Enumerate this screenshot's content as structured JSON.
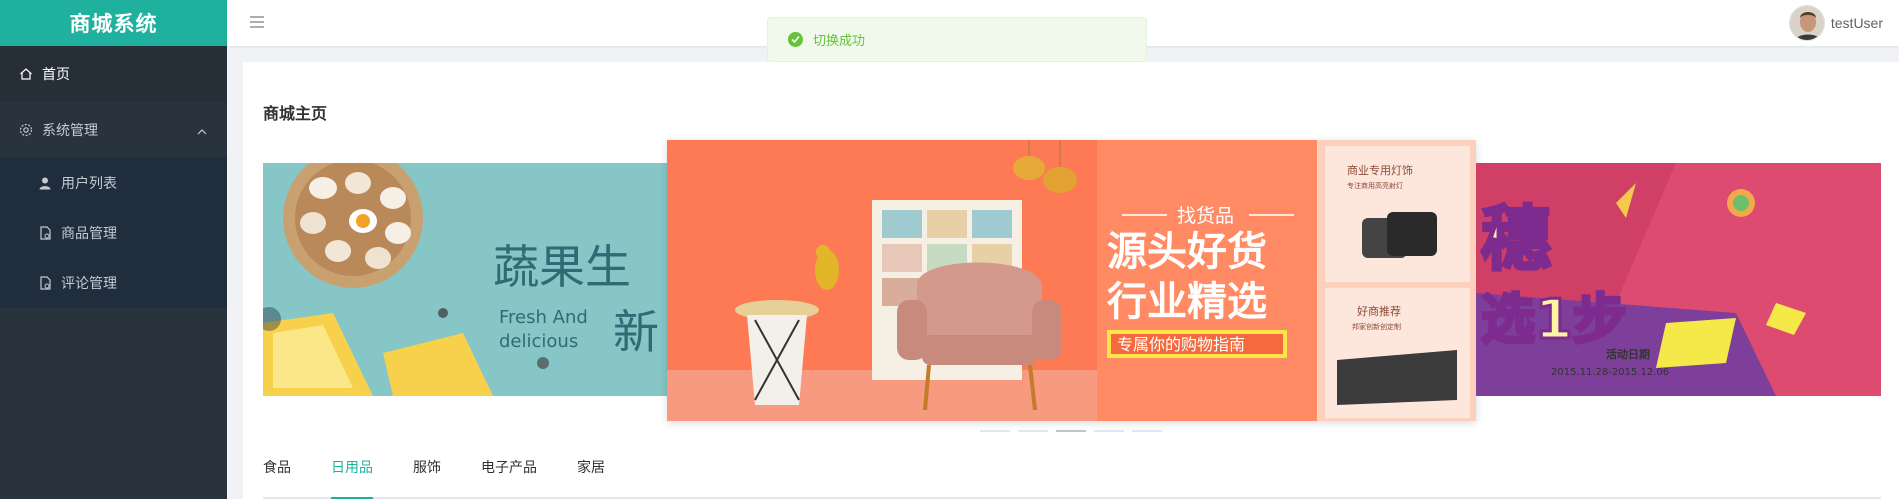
{
  "sidebar": {
    "logo": "商城系统",
    "items": [
      {
        "label": "首页",
        "icon": "home-icon"
      },
      {
        "label": "系统管理",
        "icon": "gear-icon"
      }
    ],
    "submenu": [
      {
        "label": "用户列表",
        "icon": "user-icon"
      },
      {
        "label": "商品管理",
        "icon": "document-icon"
      },
      {
        "label": "评论管理",
        "icon": "document-icon"
      }
    ]
  },
  "header": {
    "username": "testUser"
  },
  "toast": {
    "message": "切换成功"
  },
  "main": {
    "title": "商城主页",
    "carousel": {
      "left": {
        "title": "蔬果生",
        "subtitle_en_1": "Fresh And",
        "subtitle_en_2": "delicious",
        "title_2": "新"
      },
      "center": {
        "kicker": "找货品",
        "line1": "源头好货",
        "line2": "行业精选",
        "banner": "专属你的购物指南",
        "side_top_title": "商业专用灯饰",
        "side_top_sub": "专注商用高亮射灯",
        "side_bottom_title": "好商推荐",
        "side_bottom_sub": "邦家创新创定制"
      },
      "right": {
        "big1": "穗",
        "big2": "选1步",
        "tag": "活动日期",
        "date": "2015.11.28-2015.12.06"
      },
      "dot_count": 5,
      "active_dot": 2
    },
    "tabs": [
      {
        "label": "食品"
      },
      {
        "label": "日用品"
      },
      {
        "label": "服饰"
      },
      {
        "label": "电子产品"
      },
      {
        "label": "家居"
      }
    ],
    "active_tab": 1
  },
  "colors": {
    "accent": "#1fb19e",
    "sidebar_bg": "#28333e",
    "success": "#67c23a"
  }
}
